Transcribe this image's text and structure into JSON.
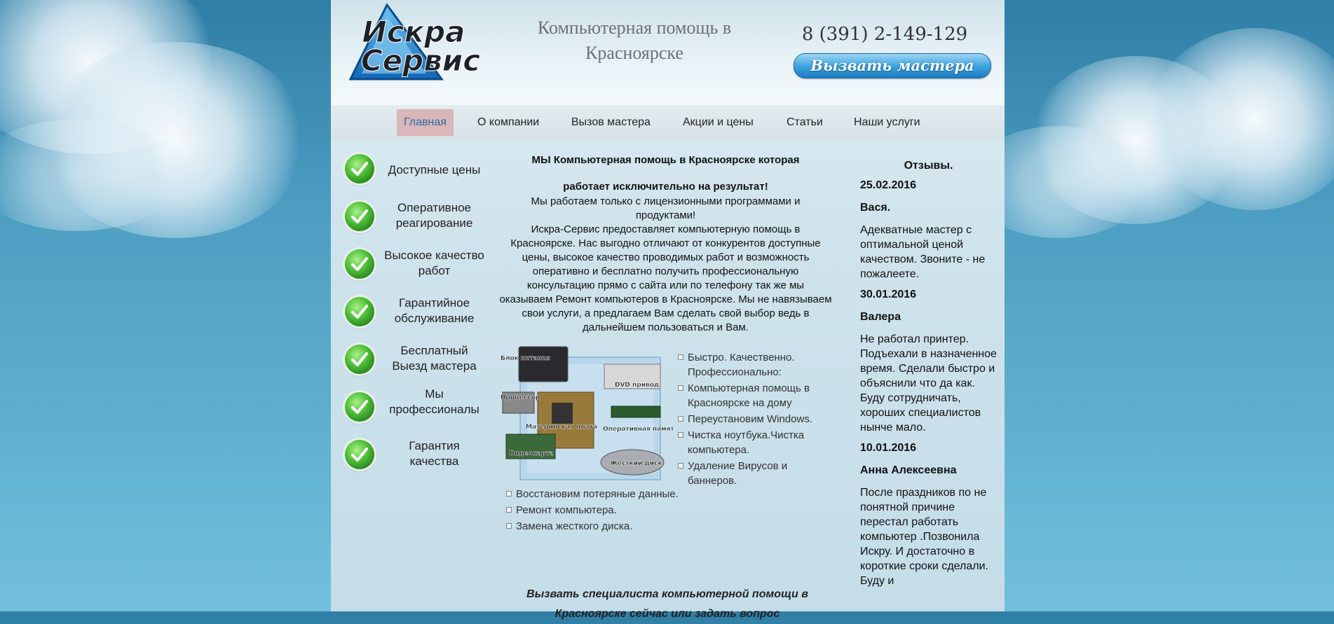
{
  "header": {
    "logo_line1": "Искра",
    "logo_line2": "Сервис",
    "tagline": "Компьютерная помощь в Красноярске",
    "phone": "8 (391) 2-149-129",
    "call_button": "Вызвать мастера"
  },
  "nav": {
    "items": [
      "Главная",
      "О компании",
      "Вызов мастера",
      "Акции и цены",
      "Статьи",
      "Наши услуги"
    ],
    "active": "Главная"
  },
  "features": [
    "Доступные цены",
    "Оперативное реагирование",
    "Высокое качество работ",
    "Гарантийное обслуживание",
    "Бесплатный Выезд мастера",
    "Мы профессионалы",
    "Гарантия качества"
  ],
  "main": {
    "title_line1": "МЫ Компьютерная помощь в Красноярске которая",
    "title_line2": "работает исключительно на результат!",
    "licensed": "Мы работаем только с лицензионными программами и продуктами!",
    "description": "Искра-Сервис предоставляет компьютерную помощь в Красноярске. Нас выгодно отличают от конкурентов доступные цены, высокое качество проводимых работ и возможность оперативно и бесплатно получить профессиональную консультацию прямо с сайта или по телефону так же мы оказываем Ремонт компьютеров в Красноярске. Мы не навязываем свои услуги, а предлагаем Вам сделать свой выбор ведь в дальнейшем пользоваться и Вам.",
    "image_labels": [
      "Блок питания",
      "Процессор",
      "Материнская плата",
      "Видеокарта",
      "DVD привод",
      "Оперативная память",
      "Жесткий диск"
    ],
    "services_right": [
      "Быстро. Качественно. Профессионально:",
      "Компьютерная помощь в Красноярске на дому",
      "Переустановим Windows.",
      "Чистка ноутбука.Чистка компьютера.",
      "Удаление Вирусов и баннеров."
    ],
    "services_bottom": [
      "Восстановим потеряные данные.",
      "Ремонт компьютера.",
      "Замена жесткого диска."
    ],
    "cta": "Вызвать специалиста компьютерной помощи в Красноярске сейчас или задать вопрос"
  },
  "reviews": {
    "title": "Отзывы.",
    "items": [
      {
        "date": "25.02.2016",
        "name": "Вася.",
        "text": "Адекватные мастер с оптимальной ценой качеством. Звоните - не пожалеете."
      },
      {
        "date": "30.01.2016",
        "name": "Валера",
        "text": "Не работал принтер. Подъехали в назначенное время. Сделали быстро и объяснили что да как. Буду сотрудничать, хороших специалистов нынче мало."
      },
      {
        "date": "10.01.2016",
        "name": "Анна Алексеевна",
        "text": "После праздников по не понятной причине перестал работать компьютер .Позвонила Искру. И достаточно в короткие сроки сделали. Буду и"
      }
    ]
  },
  "colors": {
    "page_bg": "#c4dde8",
    "accent_blue": "#1c7cc0",
    "nav_active_bg": "#d9b6b9",
    "nav_active_text": "#2c6e9a",
    "check_green": "#53c23a"
  }
}
